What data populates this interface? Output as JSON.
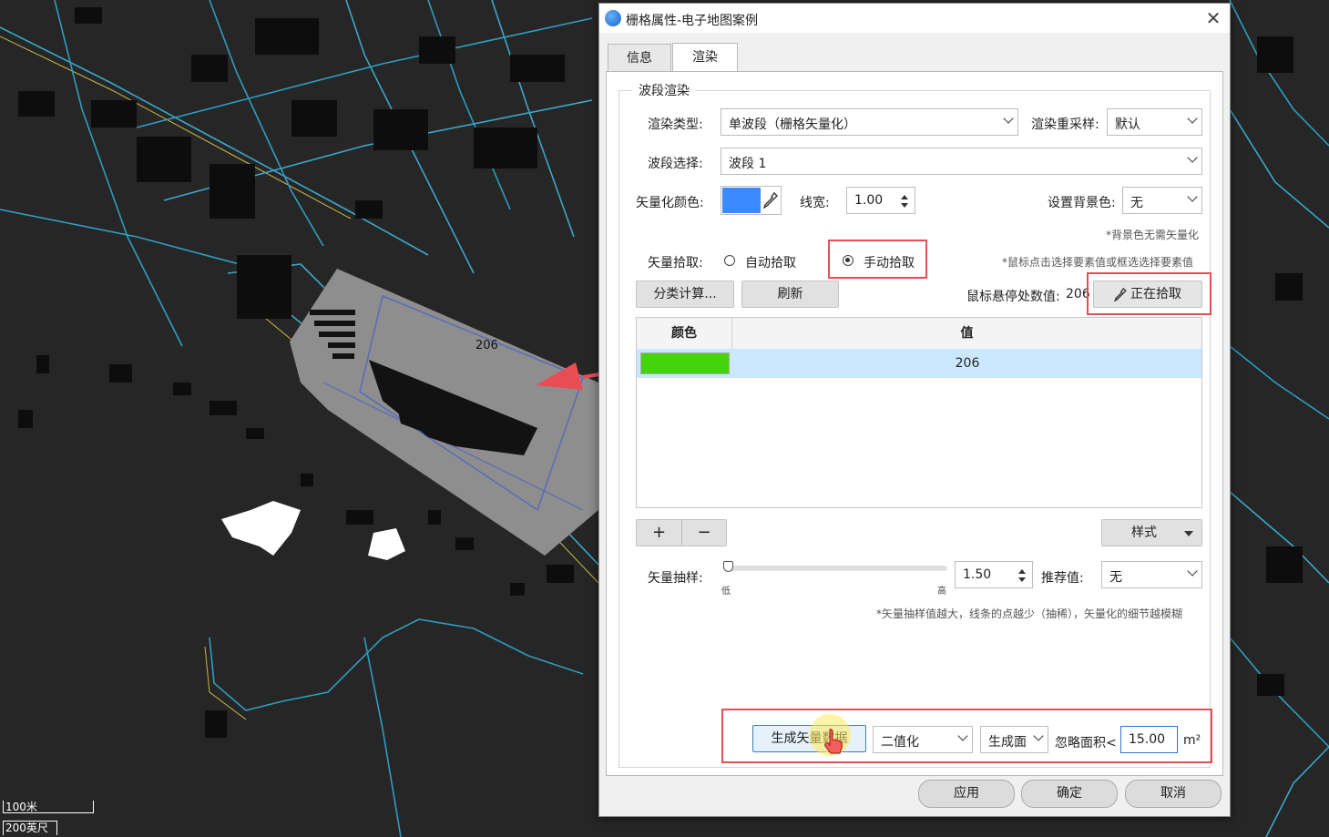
{
  "map": {
    "feature_label": "206",
    "scale_top": "100米",
    "scale_bottom": "200英尺"
  },
  "dialog": {
    "title": "栅格属性-电子地图案例",
    "close_glyph": "✕",
    "tabs": [
      {
        "label": "信息"
      },
      {
        "label": "渲染"
      }
    ],
    "active_tab": "渲染",
    "group_title": "波段渲染",
    "render_type": {
      "label": "渲染类型:",
      "value": "单波段（栅格矢量化）"
    },
    "resample": {
      "label": "渲染重采样:",
      "value": "默认"
    },
    "band": {
      "label": "波段选择:",
      "value": "波段 1"
    },
    "vector_color": {
      "label": "矢量化颜色:",
      "color": "#3b8bff"
    },
    "line_width": {
      "label": "线宽:",
      "value": "1.00"
    },
    "bg_color": {
      "label": "设置背景色:",
      "value": "无",
      "note": "*背景色无需矢量化"
    },
    "pick": {
      "label": "矢量拾取:",
      "auto": "自动拾取",
      "manual": "手动拾取",
      "selected": "manual",
      "note": "*鼠标点击选择要素值或框选选择要素值"
    },
    "classify_button": "分类计算...",
    "refresh_button": "刷新",
    "hover_value": {
      "label": "鼠标悬停处数值:",
      "value": "206"
    },
    "picking_button": "正在拾取",
    "table": {
      "headers": [
        "颜色",
        "值"
      ],
      "rows": [
        {
          "color": "#44d40e",
          "value": "206"
        }
      ]
    },
    "add_button": "+",
    "remove_button": "−",
    "style_button": "样式",
    "sampling": {
      "label": "矢量抽样:",
      "low": "低",
      "high": "高",
      "value": "1.50",
      "slider_position": 0.0,
      "recommend_label": "推荐值:",
      "recommend_value": "无",
      "note": "*矢量抽样值越大，线条的点越少（抽稀），矢量化的细节越模糊"
    },
    "generate": {
      "button": "生成矢量数据",
      "mode": "二值化",
      "output": "生成面",
      "ignore_label": "忽略面积<",
      "ignore_value": "15.00",
      "unit": "m²"
    },
    "footer": {
      "apply": "应用",
      "ok": "确定",
      "cancel": "取消"
    }
  },
  "colors": {
    "annotation_red": "#e84d55",
    "selection_row": "#cce8ff"
  }
}
